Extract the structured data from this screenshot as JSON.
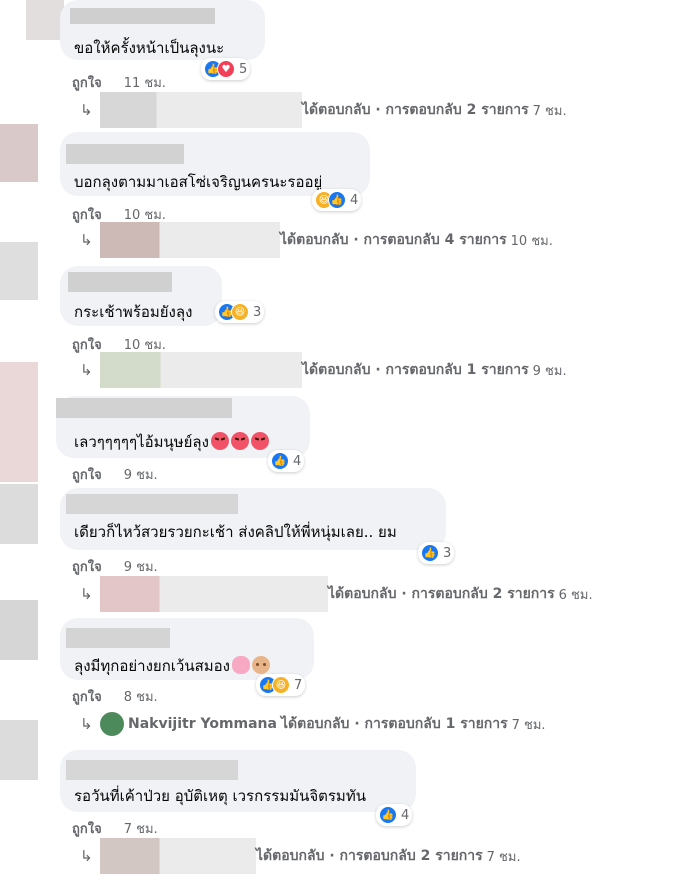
{
  "like_label": "ถูกใจ",
  "comments": [
    {
      "text": "ขอให้ครั้งหน้าเป็นลุงนะ",
      "emojis": [],
      "reaction_count": "5",
      "reaction_icons": [
        "like-icon",
        "love-icon"
      ],
      "time": "11 ชม.",
      "reply": {
        "name": "",
        "action": "ได้ตอบกลับ · การตอบกลับ 2 รายการ",
        "time": "7 ชม."
      }
    },
    {
      "text": "บอกลุงตามมาเอสโซ่เจริญนครนะรออยู่",
      "emojis": [],
      "reaction_count": "4",
      "reaction_icons": [
        "haha-icon",
        "like-icon"
      ],
      "time": "10 ชม.",
      "reply": {
        "name": "",
        "action": "ได้ตอบกลับ · การตอบกลับ 4 รายการ",
        "time": "10 ชม."
      }
    },
    {
      "text": "กระเช้าพร้อมยังลุง",
      "emojis": [],
      "reaction_count": "3",
      "reaction_icons": [
        "like-icon",
        "haha-icon"
      ],
      "time": "10 ชม.",
      "reply": {
        "name": "",
        "action": "ได้ตอบกลับ · การตอบกลับ 1 รายการ",
        "time": "9 ชม."
      }
    },
    {
      "text": "เลวๆๆๆๆๆไอ้มนุษย์ลุง",
      "emojis": [
        "angry-emoji",
        "angry-emoji",
        "angry-emoji"
      ],
      "reaction_count": "4",
      "reaction_icons": [
        "like-icon"
      ],
      "time": "9 ชม.",
      "reply": null
    },
    {
      "text": "เดียวก็ไหว้สวยรวยกะเช้า ส่งคลิปให้พี่หนุ่มเลย.. ยม",
      "emojis": [],
      "reaction_count": "3",
      "reaction_icons": [
        "like-icon"
      ],
      "time": "9 ชม.",
      "reply": {
        "name": "",
        "action": "ได้ตอบกลับ · การตอบกลับ 2 รายการ",
        "time": "6 ชม."
      }
    },
    {
      "text": "ลุงมีทุกอย่างยกเว้นสมอง",
      "emojis": [
        "brain-emoji",
        "face-emoji"
      ],
      "reaction_count": "7",
      "reaction_icons": [
        "like-icon",
        "haha-icon"
      ],
      "time": "8 ชม.",
      "reply": {
        "name": "Nakvijitr Yommana",
        "action": "ได้ตอบกลับ · การตอบกลับ 1 รายการ",
        "time": "7 ชม."
      }
    },
    {
      "text": "รอวันที่เค้าป่วย อุบัติเหตุ เวรกรรมมันจิตรมทัน",
      "emojis": [],
      "reaction_count": "4",
      "reaction_icons": [
        "like-icon"
      ],
      "time": "7 ชม.",
      "reply": {
        "name": "",
        "action": "ได้ตอบกลับ · การตอบกลับ 2 รายการ",
        "time": "7 ชม."
      }
    }
  ]
}
